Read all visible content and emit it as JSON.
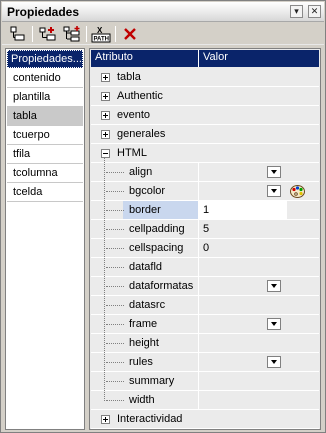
{
  "window": {
    "title": "Propiedades"
  },
  "toolbar": {
    "tools": [
      "layout-icon",
      "add-before-icon",
      "add-after-icon",
      "xpath-icon",
      "delete-icon"
    ],
    "xpath_label": "PATH"
  },
  "left": {
    "header": "Propiedades...",
    "items": [
      "contenido",
      "plantilla",
      "tabla",
      "tcuerpo",
      "tfila",
      "tcolumna",
      "tcelda"
    ],
    "selected": "tabla"
  },
  "right": {
    "col_attr": "Atributo",
    "col_val": "Valor",
    "groups": [
      {
        "label": "tabla",
        "expanded": false
      },
      {
        "label": "Authentic",
        "expanded": false
      },
      {
        "label": "evento",
        "expanded": false
      },
      {
        "label": "generales",
        "expanded": false
      },
      {
        "label": "HTML",
        "expanded": true
      }
    ],
    "props": [
      {
        "name": "align",
        "value": "",
        "dropdown": true
      },
      {
        "name": "bgcolor",
        "value": "",
        "dropdown": true,
        "color_picker": true
      },
      {
        "name": "border",
        "value": "1",
        "selected": true
      },
      {
        "name": "cellpadding",
        "value": "5"
      },
      {
        "name": "cellspacing",
        "value": "0"
      },
      {
        "name": "datafld",
        "value": ""
      },
      {
        "name": "dataformatas",
        "value": "",
        "dropdown": true
      },
      {
        "name": "datasrc",
        "value": ""
      },
      {
        "name": "frame",
        "value": "",
        "dropdown": true
      },
      {
        "name": "height",
        "value": ""
      },
      {
        "name": "rules",
        "value": "",
        "dropdown": true
      },
      {
        "name": "summary",
        "value": ""
      },
      {
        "name": "width",
        "value": ""
      }
    ],
    "last_group": {
      "label": "Interactividad",
      "expanded": false
    }
  }
}
